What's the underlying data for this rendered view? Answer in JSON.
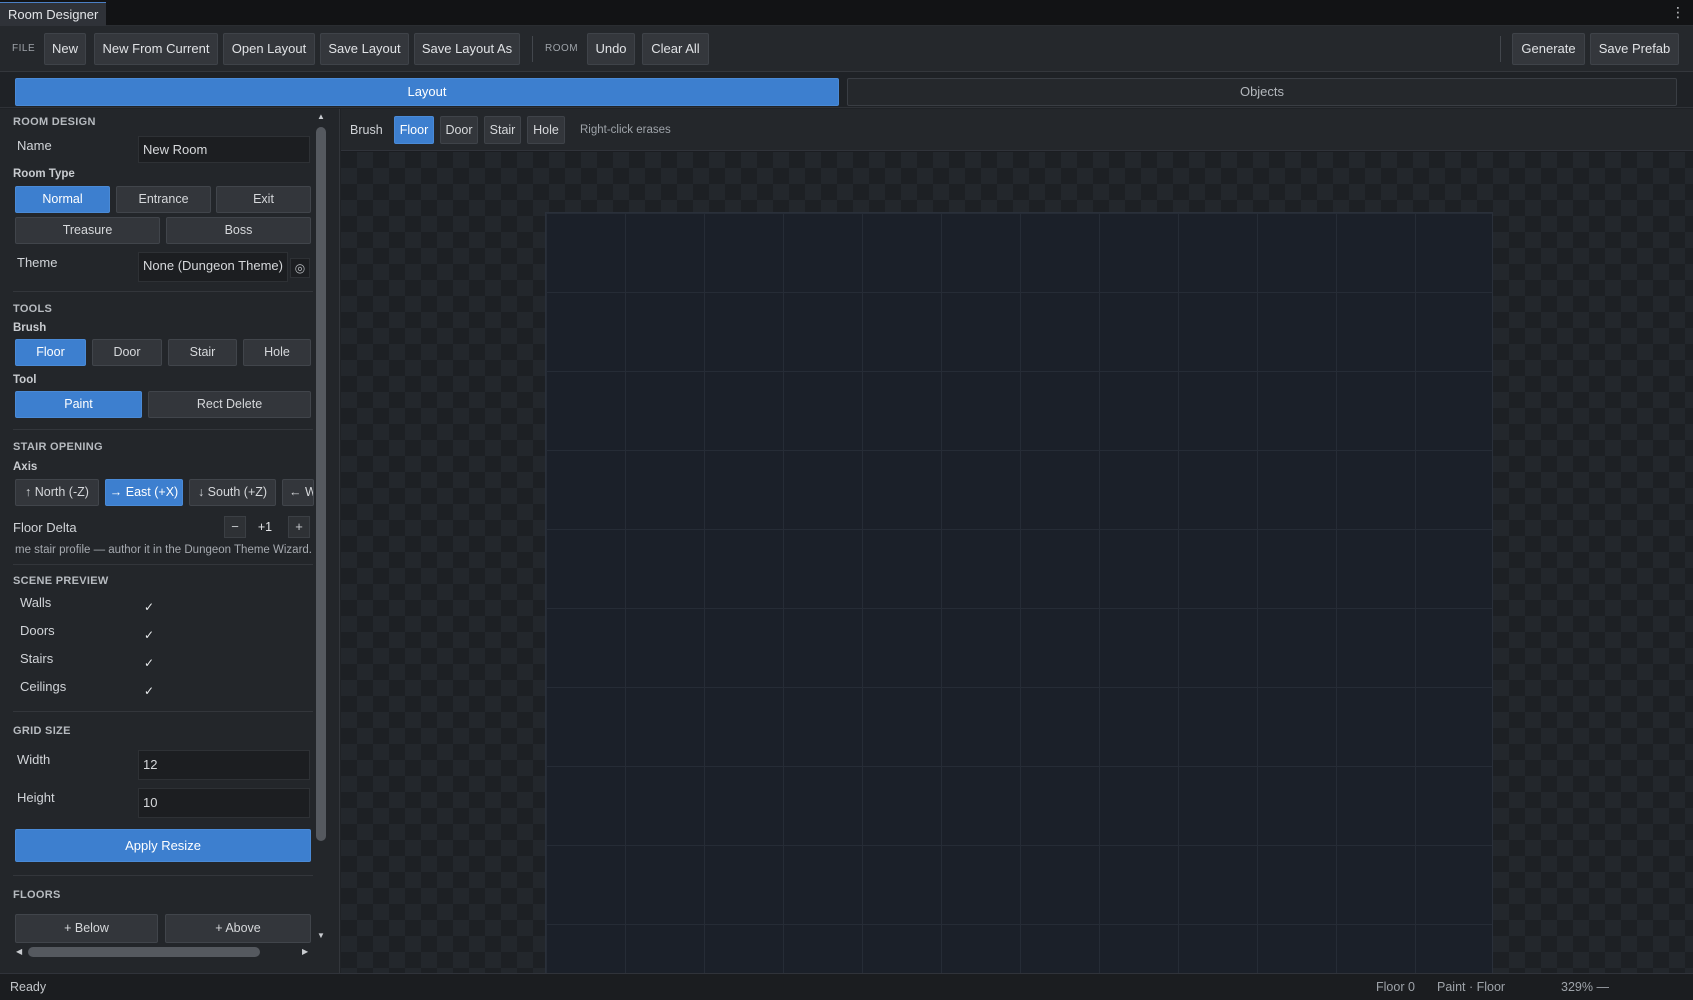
{
  "window": {
    "title": "Room Designer",
    "menu_icon": "kebab-icon"
  },
  "toolbar": {
    "file_label": "FILE",
    "new": "New",
    "new_from_current": "New From Current",
    "open_layout": "Open Layout",
    "save_layout": "Save Layout",
    "save_layout_as": "Save Layout As",
    "room_label": "ROOM",
    "undo": "Undo",
    "clear_all": "Clear All",
    "generate": "Generate",
    "save_prefab": "Save Prefab"
  },
  "mode_tabs": {
    "layout": "Layout",
    "objects": "Objects",
    "active": "Layout"
  },
  "sidebar": {
    "room_design": {
      "heading": "ROOM DESIGN",
      "name_label": "Name",
      "name_value": "New Room",
      "room_type_label": "Room Type",
      "room_types": [
        "Normal",
        "Entrance",
        "Exit",
        "Treasure",
        "Boss"
      ],
      "room_type_selected": "Normal",
      "theme_label": "Theme",
      "theme_value": "None (Dungeon Theme)",
      "theme_picker_icon": "target-icon"
    },
    "tools": {
      "heading": "TOOLS",
      "brush_label": "Brush",
      "brushes": [
        "Floor",
        "Door",
        "Stair",
        "Hole"
      ],
      "brush_selected": "Floor",
      "tool_label": "Tool",
      "tools": [
        "Paint",
        "Rect Delete"
      ],
      "tool_selected": "Paint"
    },
    "stair_opening": {
      "heading": "STAIR OPENING",
      "axis_label": "Axis",
      "axes": [
        "↑ North (-Z)",
        "→ East (+X)",
        "↓ South (+Z)",
        "← W"
      ],
      "axis_selected": "→ East (+X)",
      "floor_delta_label": "Floor Delta",
      "floor_delta_value": "+1",
      "minus": "−",
      "plus": "+",
      "hint": "me stair profile — author it in the Dungeon Theme Wizard."
    },
    "scene_preview": {
      "heading": "SCENE PREVIEW",
      "items": [
        {
          "label": "Walls",
          "checked": "✓"
        },
        {
          "label": "Doors",
          "checked": "✓"
        },
        {
          "label": "Stairs",
          "checked": "✓"
        },
        {
          "label": "Ceilings",
          "checked": "✓"
        }
      ]
    },
    "grid_size": {
      "heading": "GRID SIZE",
      "width_label": "Width",
      "width_value": "12",
      "height_label": "Height",
      "height_value": "10",
      "apply": "Apply Resize"
    },
    "floors": {
      "heading": "FLOORS",
      "below": "+ Below",
      "above": "+ Above"
    }
  },
  "brush_bar": {
    "label": "Brush",
    "options": [
      "Floor",
      "Door",
      "Stair",
      "Hole"
    ],
    "selected": "Floor",
    "hint": "Right-click erases"
  },
  "status": {
    "left": "Ready",
    "floor": "Floor 0",
    "mode": "Paint · Floor",
    "zoom": "329% —"
  },
  "colors": {
    "accent": "#3d7fcf",
    "background": "#1f2226",
    "panel": "#23262a"
  }
}
